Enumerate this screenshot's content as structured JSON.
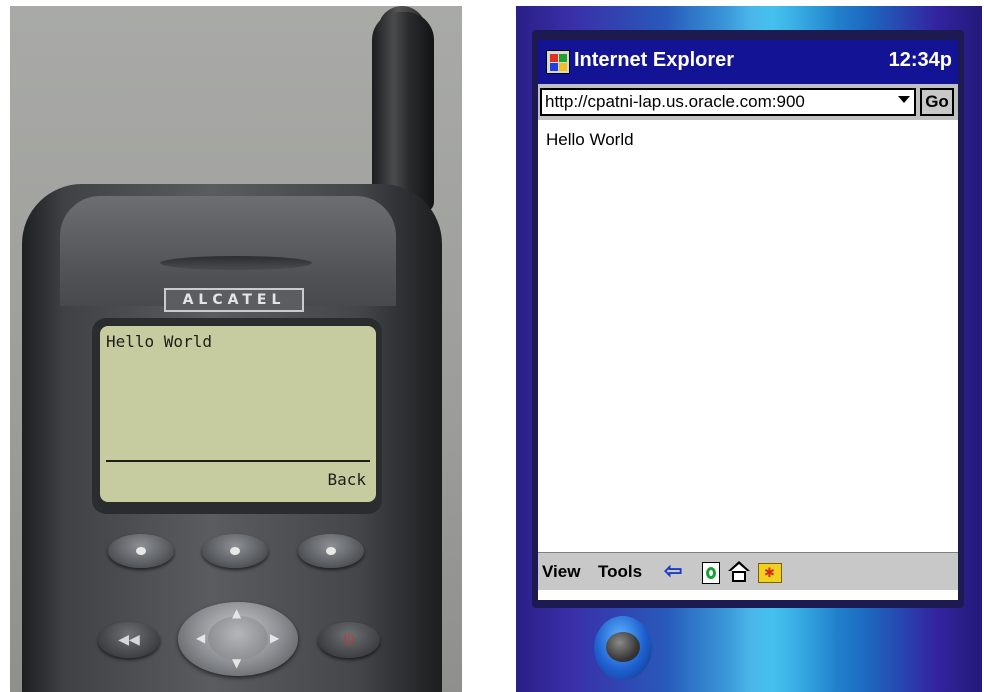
{
  "phone": {
    "brand": "ALCATEL",
    "screen_text": "Hello World",
    "softkey_label": "Back",
    "nav_arrows": {
      "up": "▲",
      "down": "▼",
      "left": "◀",
      "right": "▶"
    },
    "left_button_glyph": "◀◀",
    "right_button_glyph": "⏻",
    "lcd_color": "#c7cba0"
  },
  "pda": {
    "title": "Internet Explorer",
    "clock": "12:34p",
    "address_value": "http://cpatni-lap.us.oracle.com:900",
    "go_label": "Go",
    "page_text": "Hello World",
    "menu": {
      "view": "View",
      "tools": "Tools"
    },
    "toolbar_icons": [
      "back-arrow-icon",
      "refresh-icon",
      "home-icon",
      "favorites-icon"
    ],
    "back_glyph": "⇦",
    "favorites_glyph": "✱",
    "titlebar_color": "#131396"
  }
}
